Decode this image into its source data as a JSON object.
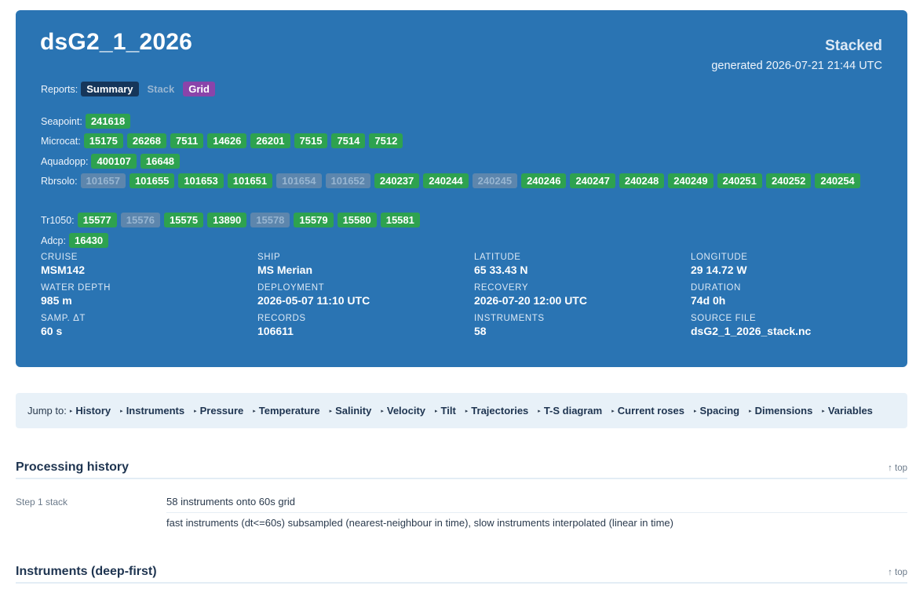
{
  "header": {
    "title": "dsG2_1_2026",
    "status": "Stacked",
    "generated": "generated 2026-07-21 21:44 UTC"
  },
  "reports": {
    "label": "Reports:",
    "items": [
      {
        "label": "Summary",
        "state": "active"
      },
      {
        "label": "Stack",
        "state": "current"
      },
      {
        "label": "Grid",
        "state": "link"
      }
    ]
  },
  "instrument_groups": [
    {
      "label": "Seapoint:",
      "items": [
        {
          "id": "241618",
          "ok": true
        }
      ]
    },
    {
      "label": "Microcat:",
      "items": [
        {
          "id": "15175",
          "ok": true
        },
        {
          "id": "26268",
          "ok": true
        },
        {
          "id": "7511",
          "ok": true
        },
        {
          "id": "14626",
          "ok": true
        },
        {
          "id": "26201",
          "ok": true
        },
        {
          "id": "7515",
          "ok": true
        },
        {
          "id": "7514",
          "ok": true
        },
        {
          "id": "7512",
          "ok": true
        }
      ]
    },
    {
      "label": "Aquadopp:",
      "items": [
        {
          "id": "400107",
          "ok": true
        },
        {
          "id": "16648",
          "ok": true
        }
      ]
    },
    {
      "label": "Rbrsolo:",
      "items": [
        {
          "id": "101657",
          "ok": false
        },
        {
          "id": "101655",
          "ok": true
        },
        {
          "id": "101653",
          "ok": true
        },
        {
          "id": "101651",
          "ok": true
        },
        {
          "id": "101654",
          "ok": false
        },
        {
          "id": "101652",
          "ok": false
        },
        {
          "id": "240237",
          "ok": true
        },
        {
          "id": "240244",
          "ok": true
        },
        {
          "id": "240245",
          "ok": false
        },
        {
          "id": "240246",
          "ok": true
        },
        {
          "id": "240247",
          "ok": true
        },
        {
          "id": "240248",
          "ok": true
        },
        {
          "id": "240249",
          "ok": true
        },
        {
          "id": "240251",
          "ok": true
        },
        {
          "id": "240252",
          "ok": true
        },
        {
          "id": "240254",
          "ok": true
        }
      ]
    },
    {
      "label": "Tr1050:",
      "items": [
        {
          "id": "15577",
          "ok": true
        },
        {
          "id": "15576",
          "ok": false
        },
        {
          "id": "15575",
          "ok": true
        },
        {
          "id": "13890",
          "ok": true
        },
        {
          "id": "15578",
          "ok": false
        },
        {
          "id": "15579",
          "ok": true
        },
        {
          "id": "15580",
          "ok": true
        },
        {
          "id": "15581",
          "ok": true
        }
      ]
    },
    {
      "label": "Adcp:",
      "items": [
        {
          "id": "16430",
          "ok": true
        }
      ]
    }
  ],
  "meta": [
    {
      "key": "CRUISE",
      "value": "MSM142"
    },
    {
      "key": "SHIP",
      "value": "MS Merian"
    },
    {
      "key": "LATITUDE",
      "value": "65 33.43 N"
    },
    {
      "key": "LONGITUDE",
      "value": "29 14.72 W"
    },
    {
      "key": "WATER DEPTH",
      "value": "985 m"
    },
    {
      "key": "DEPLOYMENT",
      "value": "2026-05-07 11:10 UTC"
    },
    {
      "key": "RECOVERY",
      "value": "2026-07-20 12:00 UTC"
    },
    {
      "key": "DURATION",
      "value": "74d 0h"
    },
    {
      "key": "SAMP. ΔT",
      "value": "60 s"
    },
    {
      "key": "RECORDS",
      "value": "106611"
    },
    {
      "key": "INSTRUMENTS",
      "value": "58"
    },
    {
      "key": "SOURCE FILE",
      "value": "dsG2_1_2026_stack.nc"
    }
  ],
  "jump": {
    "label": "Jump to:",
    "links": [
      "History",
      "Instruments",
      "Pressure",
      "Temperature",
      "Salinity",
      "Velocity",
      "Tilt",
      "Trajectories",
      "T-S diagram",
      "Current roses",
      "Spacing",
      "Dimensions",
      "Variables"
    ]
  },
  "history": {
    "title": "Processing history",
    "top_label": "↑ top",
    "step": "Step 1 stack",
    "line1": "58 instruments onto 60s grid",
    "line2": "fast instruments (dt<=60s) subsampled (nearest-neighbour in time), slow instruments interpolated (linear in time)"
  },
  "instruments_section": {
    "title": "Instruments (deep-first)",
    "top_label": "↑ top"
  },
  "colors": {
    "header_bg": "#2a74b3",
    "chip_ok": "#2ea24f",
    "chip_off": "#5d86ad",
    "summary_chip": "#16365a",
    "grid_chip": "#8a44aa",
    "jump_bg": "#e8f1f8"
  }
}
